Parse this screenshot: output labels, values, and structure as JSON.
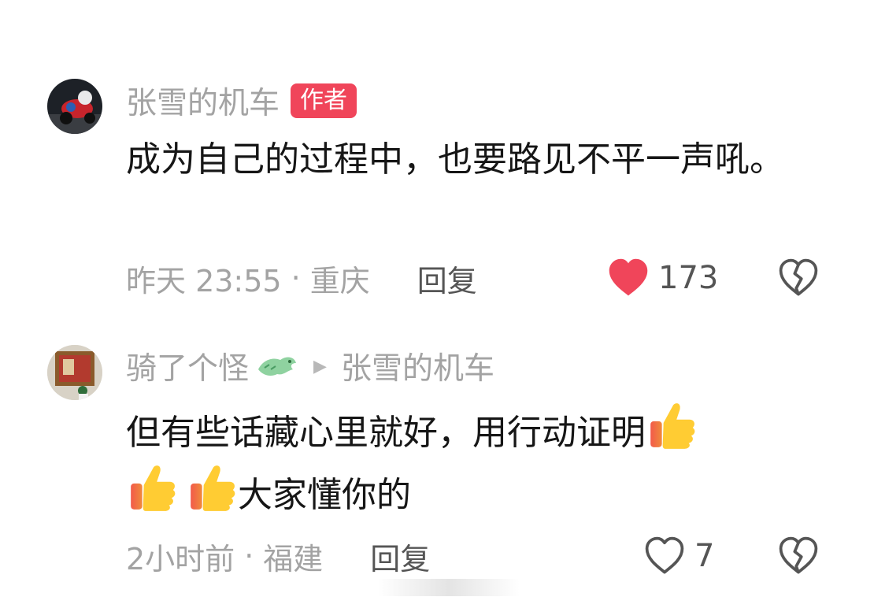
{
  "comments": [
    {
      "author": "张雪的机车",
      "badge": "作者",
      "text": "成为自己的过程中，也要路见不平一声吼。",
      "time": "昨天 23:55",
      "separator": "·",
      "location": "重庆",
      "reply_label": "回复",
      "likes": "173",
      "liked": true,
      "avatar_icon": "motorcycle-racer-avatar"
    },
    {
      "author": "骑了个怪",
      "author_icon": "dragon-icon",
      "reply_to": "张雪的机车",
      "text_part1": "但有些话藏心里就好，用行动证明",
      "text_part2": "大家懂你的",
      "text_emojis": [
        "thumbs-up-emoji",
        "thumbs-up-emoji",
        "thumbs-up-emoji"
      ],
      "time": "2小时前",
      "separator": "·",
      "location": "福建",
      "reply_label": "回复",
      "likes": "7",
      "liked": false,
      "avatar_icon": "painting-avatar"
    }
  ],
  "colors": {
    "accent": "#f0455a",
    "muted_text": "#a3a3a3",
    "body_text": "#161616"
  }
}
